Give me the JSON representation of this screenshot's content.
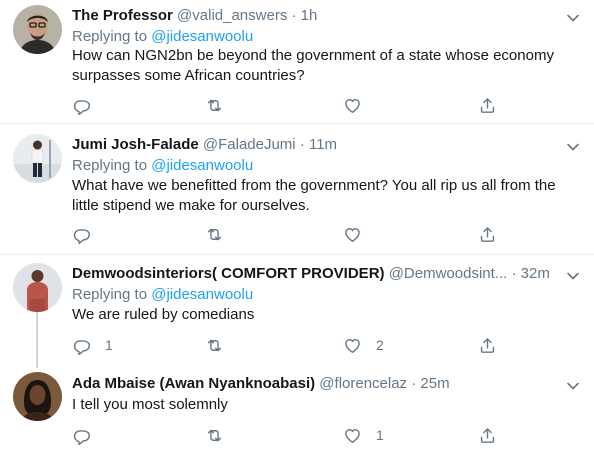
{
  "tweets": [
    {
      "name": "The Professor",
      "handle": "@valid_answers",
      "dot": "·",
      "time": "1h",
      "replying_prefix": "Replying to ",
      "replying_to": "@jidesanwoolu",
      "text_line1": "How can NGN2bn be beyond the government of a state whose economy",
      "text_line2": "surpasses some African countries?",
      "reply_count": "",
      "retweet_count": "",
      "like_count": ""
    },
    {
      "name": "Jumi Josh-Falade",
      "handle": "@FaladeJumi",
      "dot": "·",
      "time": "11m",
      "replying_prefix": "Replying to ",
      "replying_to": "@jidesanwoolu",
      "text_line1": "What have we benefitted from the government? You all rip us all from the",
      "text_line2": "little stipend we make for ourselves.",
      "reply_count": "",
      "retweet_count": "",
      "like_count": ""
    },
    {
      "name": "Demwoodsinteriors( COMFORT PROVIDER)",
      "handle": "@Demwoodsint...",
      "dot": "·",
      "time": "32m",
      "replying_prefix": "Replying to ",
      "replying_to": "@jidesanwoolu",
      "text_line1": "We are ruled by comedians",
      "text_line2": "",
      "reply_count": "1",
      "retweet_count": "",
      "like_count": "2"
    },
    {
      "name": "Ada Mbaise (Awan Nyanknoabasi)",
      "handle": "@florencelaz",
      "dot": "·",
      "time": "25m",
      "replying_prefix": "",
      "replying_to": "",
      "text_line1": "I tell you most solemnly",
      "text_line2": "",
      "reply_count": "",
      "retweet_count": "",
      "like_count": "1"
    }
  ],
  "icons": {
    "reply": "reply-icon",
    "retweet": "retweet-icon",
    "like": "heart-icon",
    "share": "share-icon",
    "more": "chevron-down-icon"
  },
  "colors": {
    "link": "#1da1f2",
    "secondary_text": "#657786",
    "divider": "#e6ecf0",
    "thread_line": "#ccd6dd"
  }
}
